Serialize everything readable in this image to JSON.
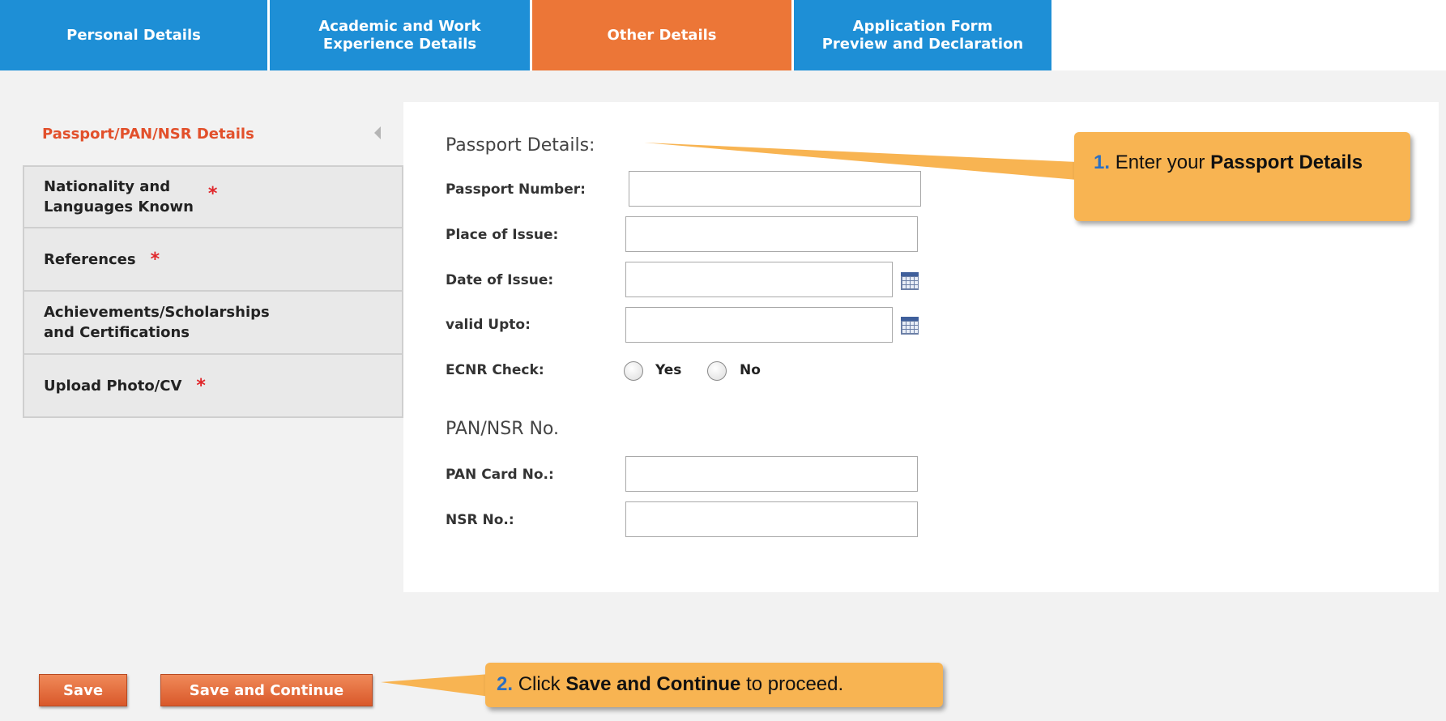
{
  "tabs": [
    {
      "line1": "Personal Details",
      "line2": ""
    },
    {
      "line1": "Academic and Work",
      "line2": "Experience Details"
    },
    {
      "line1": "Other Details",
      "line2": ""
    },
    {
      "line1": "Application Form",
      "line2": "Preview and Declaration"
    }
  ],
  "active_tab": "Other Details",
  "sidenav": {
    "items": [
      {
        "line1": "Passport/PAN/NSR Details",
        "line2": "",
        "required": false
      },
      {
        "line1": "Nationality and",
        "line2": "Languages Known",
        "required": true
      },
      {
        "line1": "References",
        "line2": "",
        "required": true
      },
      {
        "line1": "Achievements/Scholarships",
        "line2": "and Certifications",
        "required": false
      },
      {
        "line1": "Upload Photo/CV",
        "line2": "",
        "required": true
      }
    ],
    "required_mark": "*"
  },
  "form": {
    "passport_title": "Passport Details:",
    "passport_number_label": "Passport Number:",
    "place_of_issue_label": "Place of Issue:",
    "date_of_issue_label": "Date of Issue:",
    "valid_upto_label": "valid Upto:",
    "ecnr_label": "ECNR Check:",
    "ecnr_options": [
      "Yes",
      "No"
    ],
    "pan_title": "PAN/NSR No.",
    "pan_label": "PAN Card No.:",
    "nsr_label": "NSR No.:"
  },
  "callouts": {
    "one": {
      "num": "1.",
      "text": "Enter your",
      "bold": "Passport Details"
    },
    "two": {
      "num": "2.",
      "text": "Click",
      "bold": "Save and Continue",
      "tail": "to proceed."
    }
  },
  "buttons": {
    "save": "Save",
    "save_continue": "Save and Continue"
  },
  "colors": {
    "tab_blue": "#1e8fd6",
    "tab_active": "#ec7637",
    "callout": "#f8b452",
    "button": "#e0622f"
  }
}
